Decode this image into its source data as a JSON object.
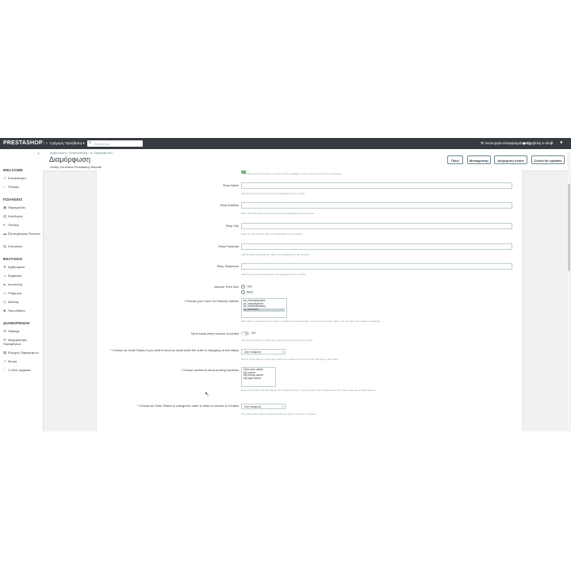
{
  "topbar": {
    "logo": "PRESTASHOP",
    "version": "1.7.8",
    "quick_access": "Γρήγορη Πρόσβαση ▾",
    "search_placeholder": "Αναζήτηση",
    "right_items": [
      "Λειτουργία αποσφαλμάτωσης",
      "Προβολή e-shop"
    ]
  },
  "sidebar": {
    "sections": [
      {
        "title": "WELCOME",
        "items": [
          {
            "label": "Επισκόπηση",
            "icon": "trend-icon"
          },
          {
            "label": "Πίνακας",
            "icon": "home-icon"
          }
        ]
      },
      {
        "title": "ΠΩΛΗΣΕΙΣ",
        "items": [
          {
            "label": "Παραγγελίες",
            "icon": "cart-icon"
          },
          {
            "label": "Κατάλογος",
            "icon": "store-icon"
          },
          {
            "label": "Πελάτες",
            "icon": "user-icon"
          },
          {
            "label": "Εξυπηρέτηση Πελατών",
            "icon": "chat-icon"
          },
          {
            "label": "Στατιστικά",
            "icon": "stats-icon"
          }
        ]
      },
      {
        "title": "ΒΕΛΤΙΩΣΗ",
        "items": [
          {
            "label": "Αρθρώματα",
            "icon": "puzzle-icon"
          },
          {
            "label": "Εμφάνιση",
            "icon": "desktop-icon"
          },
          {
            "label": "Αποστολή",
            "icon": "truck-icon"
          },
          {
            "label": "Πληρωμή",
            "icon": "card-icon"
          },
          {
            "label": "Διεθνής",
            "icon": "globe-icon"
          },
          {
            "label": "Προωθήσεις",
            "icon": "tag-icon"
          }
        ]
      },
      {
        "title": "ΔΙΑΜΟΡΦΩΣΗ",
        "items": [
          {
            "label": "Settings",
            "icon": "gear-icon"
          },
          {
            "label": "Διαχειρίστηκε Παραμέτρων",
            "icon": "settings-icon"
          },
          {
            "label": "Ελέγχος Παραμέτρων",
            "icon": "grid-icon"
          },
          {
            "label": "Μετρα",
            "icon": "trend-icon"
          },
          {
            "label": "1-Click Upgrade",
            "icon": "upgrade-icon"
          }
        ]
      }
    ]
  },
  "header": {
    "breadcrumb": "Αρθρώματα  /  Ανασκόπηση  /  εν διαμόρφωσει",
    "title": "Διαμόρφωση",
    "subtitle": "Geeky Vouchers Prestashop Module",
    "buttons": [
      "Πίσω",
      "Μεταφρασης",
      "Διαχείριση hooks",
      "Check for updates"
    ]
  },
  "form": {
    "top_help": "If you leave this unchecked, a voucher will be available to use at the end of the day of purchase",
    "fields": [
      {
        "label": "Shop Name",
        "help": "Add the shop name you want to be displayed on the voucher"
      },
      {
        "label": "Shop Address",
        "help": "Enter the Shop Address that you want to be displayed on the voucher"
      },
      {
        "label": "Shop City",
        "help": "Enter the city that you want to be displayed on the voucher"
      },
      {
        "label": "Shop Postcode",
        "help": "Add the Shop postcode you want to be displayed on the voucher"
      },
      {
        "label": "Shop Telephone",
        "help": "Add the shop phone you want to be displayed on the voucher"
      }
    ],
    "print_size_label": "Voucher Print Size",
    "print_size_options": [
      "Thin",
      "Wide"
    ],
    "cod_label": "* Choose your Cash On Delivery Options",
    "cod_options": [
      "ps_checkpayment",
      "ps_wirepayment",
      "ps_cashondelivery",
      "ps_bankwire"
    ],
    "cod_help": "With COD, remember that you have to install the desired module. If you dont need this option, you can leave all modules unselected",
    "send_email_label": "Send email when voucher is printed",
    "send_email_value": "NO",
    "send_email_help": "The customer will be notified via email when their voucher is printed",
    "status_label": "* Choose an Order Status if you want to send an email when the order is changing on this status",
    "status_value": "Στην αναμονή",
    "status_help": "Set the Order Status to send an email to the customer when the order changes to this status",
    "carriers_label": "* Choose carriers to show printing functions",
    "carriers": [
      "Click and collect",
      "My carrier",
      "My cheap carrier",
      "My light carrier"
    ],
    "carriers_help": "Select the carriers that will display the printing function, so you can print the vouchers when the order uses one of these carriers",
    "change_status_label": "* Choose an Order Status to change the order to when a voucher is Created",
    "change_status_value": "Στην αναμονή",
    "change_status_help": "The order status will be changed to this one when a voucher is created"
  }
}
